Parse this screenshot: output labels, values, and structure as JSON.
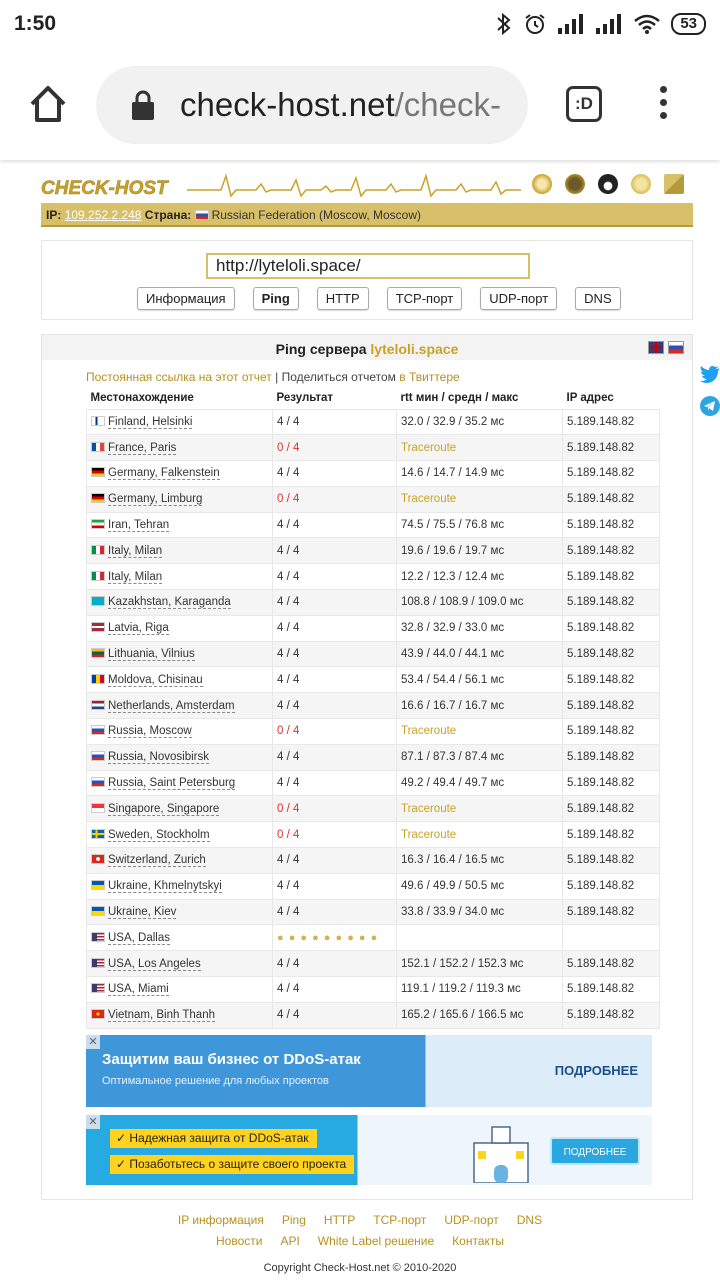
{
  "status": {
    "time": "1:50",
    "battery": "53"
  },
  "browser": {
    "url_host": "check-host.net",
    "url_path": "/check-",
    "tabs_label": ":D"
  },
  "site": {
    "ip_label": "IP:",
    "ip": "109.252.2.248",
    "country_label": "Страна:",
    "country": "Russian Federation (Moscow, Moscow)",
    "host_input": "http://lyteloli.space/",
    "buttons": [
      "Информация",
      "Ping",
      "HTTP",
      "TCP-порт",
      "UDP-порт",
      "DNS"
    ],
    "active_button": "Ping"
  },
  "result": {
    "title_prefix": "Ping сервера",
    "host": "lyteloli.space",
    "permalink": "Постоянная ссылка на этот отчет",
    "share_sep": " | ",
    "share_text": "Поделиться отчетом",
    "share_link": "в Твиттере",
    "headers": [
      "Местонахождение",
      "Результат",
      "rtt мин / средн / макс",
      "IP адрес"
    ],
    "rows": [
      {
        "flag": "fi",
        "loc": "Finland, Helsinki",
        "res": "4 / 4",
        "rtt": "32.0 / 32.9 / 35.2 мс",
        "ip": "5.189.148.82"
      },
      {
        "flag": "fr",
        "loc": "France, Paris",
        "res": "0 / 4",
        "rtt": "Traceroute",
        "ip": "5.189.148.82"
      },
      {
        "flag": "de",
        "loc": "Germany, Falkenstein",
        "res": "4 / 4",
        "rtt": "14.6 / 14.7 / 14.9 мс",
        "ip": "5.189.148.82"
      },
      {
        "flag": "de",
        "loc": "Germany, Limburg",
        "res": "0 / 4",
        "rtt": "Traceroute",
        "ip": "5.189.148.82"
      },
      {
        "flag": "ir",
        "loc": "Iran, Tehran",
        "res": "4 / 4",
        "rtt": "74.5 / 75.5 / 76.8 мс",
        "ip": "5.189.148.82"
      },
      {
        "flag": "it",
        "loc": "Italy, Milan",
        "res": "4 / 4",
        "rtt": "19.6 / 19.6 / 19.7 мс",
        "ip": "5.189.148.82"
      },
      {
        "flag": "it",
        "loc": "Italy, Milan",
        "res": "4 / 4",
        "rtt": "12.2 / 12.3 / 12.4 мс",
        "ip": "5.189.148.82"
      },
      {
        "flag": "kz",
        "loc": "Kazakhstan, Karaganda",
        "res": "4 / 4",
        "rtt": "108.8 / 108.9 / 109.0 мс",
        "ip": "5.189.148.82"
      },
      {
        "flag": "lv",
        "loc": "Latvia, Riga",
        "res": "4 / 4",
        "rtt": "32.8 / 32.9 / 33.0 мс",
        "ip": "5.189.148.82"
      },
      {
        "flag": "lt",
        "loc": "Lithuania, Vilnius",
        "res": "4 / 4",
        "rtt": "43.9 / 44.0 / 44.1 мс",
        "ip": "5.189.148.82"
      },
      {
        "flag": "md",
        "loc": "Moldova, Chisinau",
        "res": "4 / 4",
        "rtt": "53.4 / 54.4 / 56.1 мс",
        "ip": "5.189.148.82"
      },
      {
        "flag": "nl",
        "loc": "Netherlands, Amsterdam",
        "res": "4 / 4",
        "rtt": "16.6 / 16.7 / 16.7 мс",
        "ip": "5.189.148.82"
      },
      {
        "flag": "ru",
        "loc": "Russia, Moscow",
        "res": "0 / 4",
        "rtt": "Traceroute",
        "ip": "5.189.148.82"
      },
      {
        "flag": "ru",
        "loc": "Russia, Novosibirsk",
        "res": "4 / 4",
        "rtt": "87.1 / 87.3 / 87.4 мс",
        "ip": "5.189.148.82"
      },
      {
        "flag": "ru",
        "loc": "Russia, Saint Petersburg",
        "res": "4 / 4",
        "rtt": "49.2 / 49.4 / 49.7 мс",
        "ip": "5.189.148.82"
      },
      {
        "flag": "sg",
        "loc": "Singapore, Singapore",
        "res": "0 / 4",
        "rtt": "Traceroute",
        "ip": "5.189.148.82"
      },
      {
        "flag": "se",
        "loc": "Sweden, Stockholm",
        "res": "0 / 4",
        "rtt": "Traceroute",
        "ip": "5.189.148.82"
      },
      {
        "flag": "ch",
        "loc": "Switzerland, Zurich",
        "res": "4 / 4",
        "rtt": "16.3 / 16.4 / 16.5 мс",
        "ip": "5.189.148.82"
      },
      {
        "flag": "ua",
        "loc": "Ukraine, Khmelnytskyi",
        "res": "4 / 4",
        "rtt": "49.6 / 49.9 / 50.5 мс",
        "ip": "5.189.148.82"
      },
      {
        "flag": "ua",
        "loc": "Ukraine, Kiev",
        "res": "4 / 4",
        "rtt": "33.8 / 33.9 / 34.0 мс",
        "ip": "5.189.148.82"
      },
      {
        "flag": "us",
        "loc": "USA, Dallas",
        "res": "",
        "rtt": "",
        "ip": "",
        "pending": true
      },
      {
        "flag": "us",
        "loc": "USA, Los Angeles",
        "res": "4 / 4",
        "rtt": "152.1 / 152.2 / 152.3 мс",
        "ip": "5.189.148.82"
      },
      {
        "flag": "us",
        "loc": "USA, Miami",
        "res": "4 / 4",
        "rtt": "119.1 / 119.2 / 119.3 мс",
        "ip": "5.189.148.82"
      },
      {
        "flag": "vn",
        "loc": "Vietnam, Binh Thanh",
        "res": "4 / 4",
        "rtt": "165.2 / 165.6 / 166.5 мс",
        "ip": "5.189.148.82"
      }
    ]
  },
  "ads": {
    "ad1_title": "Защитим ваш бизнес от DDoS-атак",
    "ad1_sub": "Оптимальное решение для любых проектов",
    "ad1_cta": "ПОДРОБНЕЕ",
    "ad2_item1": "Надежная защита от DDoS-атак",
    "ad2_item2": "Позаботьтесь о защите своего проекта",
    "ad2_cta": "ПОДРОБНЕЕ",
    "close": "✕"
  },
  "footer": {
    "row1": [
      "IP информация",
      "Ping",
      "HTTP",
      "TCP-порт",
      "UDP-порт",
      "DNS"
    ],
    "row2": [
      "Новости",
      "API",
      "White Label решение",
      "Контакты"
    ],
    "copyright": "Copyright Check-Host.net © 2010-2020"
  },
  "colors": {
    "gold": "#d8c06a",
    "fail": "#e0322b",
    "link": "#b79020"
  }
}
